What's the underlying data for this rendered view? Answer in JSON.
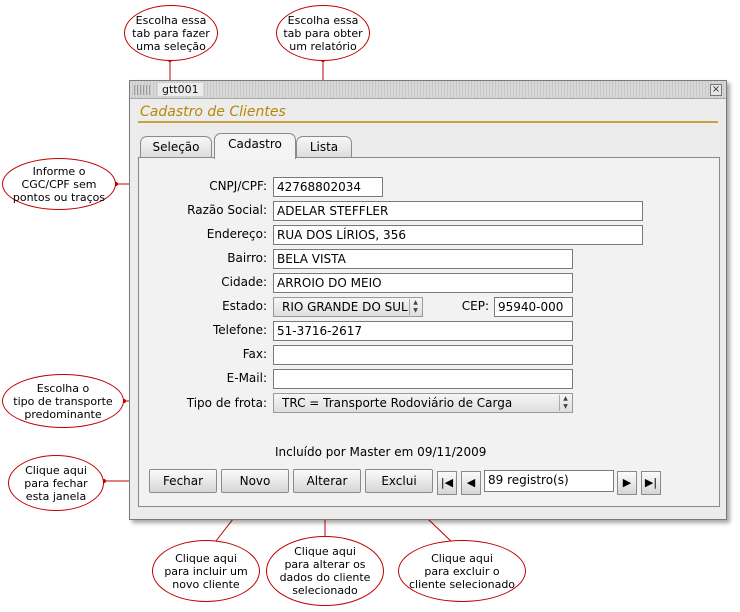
{
  "window": {
    "title": "gtt001",
    "close_glyph": "×",
    "form_title": "Cadastro de Clientes"
  },
  "tabs": [
    {
      "label": "Seleção"
    },
    {
      "label": "Cadastro"
    },
    {
      "label": "Lista"
    }
  ],
  "form": {
    "cnpj_label": "CNPJ/CPF:",
    "cnpj_value": "42768802034",
    "razao_label": "Razão Social:",
    "razao_value": "ADELAR STEFFLER",
    "endereco_label": "Endereço:",
    "endereco_value": "RUA DOS LÍRIOS, 356",
    "bairro_label": "Bairro:",
    "bairro_value": "BELA VISTA",
    "cidade_label": "Cidade:",
    "cidade_value": "ARROIO DO MEIO",
    "estado_label": "Estado:",
    "estado_value": "RIO GRANDE DO SUL",
    "cep_label": "CEP:",
    "cep_value": "95940-000",
    "telefone_label": "Telefone:",
    "telefone_value": "51-3716-2617",
    "fax_label": "Fax:",
    "fax_value": "",
    "email_label": "E-Mail:",
    "email_value": "",
    "frota_label": "Tipo de frota:",
    "frota_value": "TRC = Transporte Rodoviário de Carga",
    "included_text": "Incluído por Master em 09/11/2009"
  },
  "buttons": {
    "fechar": "Fechar",
    "novo": "Novo",
    "alterar": "Alterar",
    "excluir": "Exclui"
  },
  "navigator": {
    "records": "89 registro(s)"
  },
  "callouts": {
    "selecao": [
      "Escolha essa",
      "tab para fazer",
      "uma seleção"
    ],
    "relatorio": [
      "Escolha essa",
      "tab para obter",
      "um relatório"
    ],
    "cnpj": [
      "Informe o",
      "CGC/CPF sem",
      "pontos ou traços"
    ],
    "frota": [
      "Escolha o",
      "tipo de transporte",
      "predominante"
    ],
    "fechar": [
      "Clique aqui",
      "para fechar",
      "esta janela"
    ],
    "incluir": [
      "Clique aqui",
      "para incluir um",
      "novo cliente"
    ],
    "alterar": [
      "Clique aqui",
      "para alterar os",
      "dados do cliente",
      "selecionado"
    ],
    "excluir": [
      "Clique aqui",
      "para excluir o",
      "cliente selecionado"
    ]
  },
  "colors": {
    "callout_border": "#c00000",
    "title_accent": "#b8860b"
  }
}
